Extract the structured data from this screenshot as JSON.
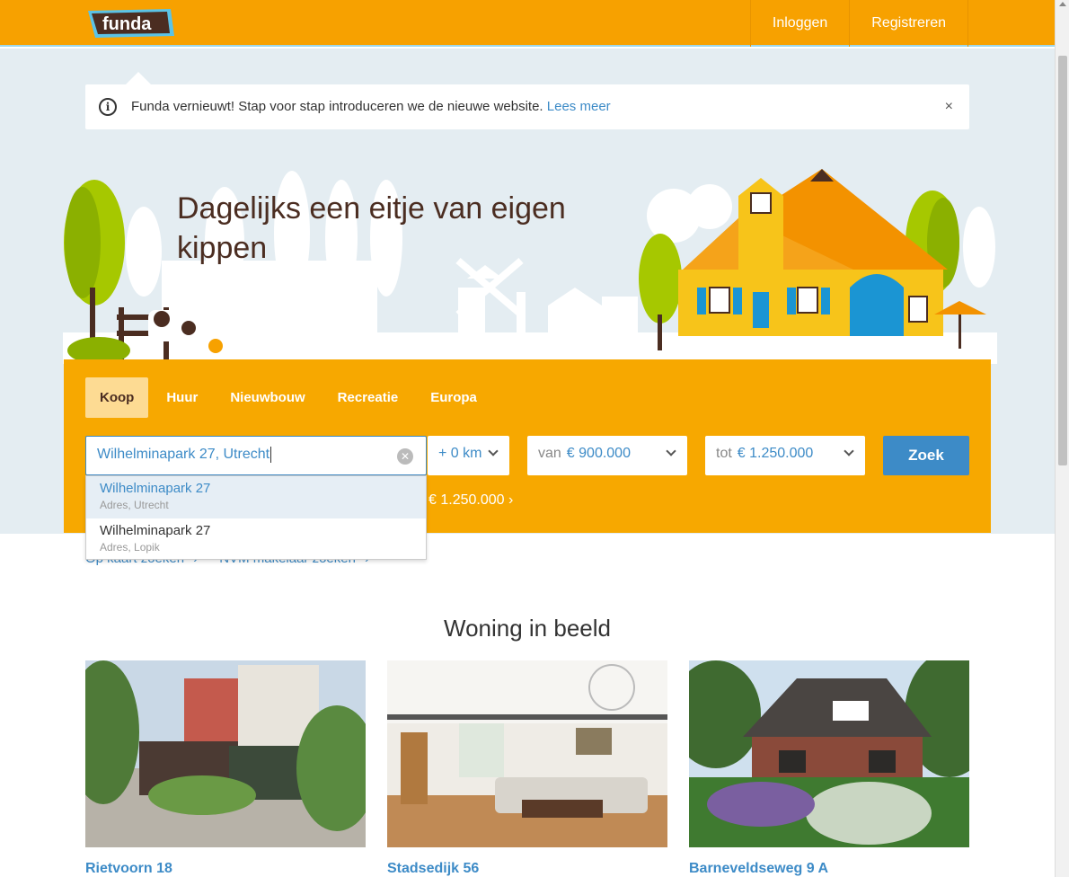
{
  "header": {
    "logo_text": "funda",
    "nav": {
      "login": "Inloggen",
      "register": "Registreren"
    }
  },
  "notice": {
    "text": "Funda vernieuwt! Stap voor stap introduceren we de nieuwe website.",
    "link": "Lees meer",
    "close": "×"
  },
  "hero": {
    "title": "Dagelijks een eitje van eigen kippen"
  },
  "search": {
    "tabs": [
      "Koop",
      "Huur",
      "Nieuwbouw",
      "Recreatie",
      "Europa"
    ],
    "active_tab": "Koop",
    "query": "Wilhelminapark 27, Utrecht",
    "radius": "+ 0 km",
    "van_label": "van",
    "van_value": "€ 900.000",
    "tot_label": "tot",
    "tot_value": "€ 1.250.000",
    "submit": "Zoek",
    "saved_search": "€ 1.250.000"
  },
  "autocomplete": [
    {
      "title": "Wilhelminapark 27",
      "sub": "Adres, Utrecht"
    },
    {
      "title": "Wilhelminapark 27",
      "sub": "Adres, Lopik"
    }
  ],
  "links": {
    "map": "Op kaart zoeken",
    "makelaar": "NVM makelaar zoeken"
  },
  "section": {
    "title": "Woning in beeld",
    "cards": [
      {
        "name": "Rietvoorn 18"
      },
      {
        "name": "Stadsedijk 56"
      },
      {
        "name": "Barneveldseweg 9 A"
      }
    ]
  },
  "colors": {
    "brand": "#f7a100",
    "link": "#3d8bc7",
    "hero_bg": "#e4edf2"
  }
}
